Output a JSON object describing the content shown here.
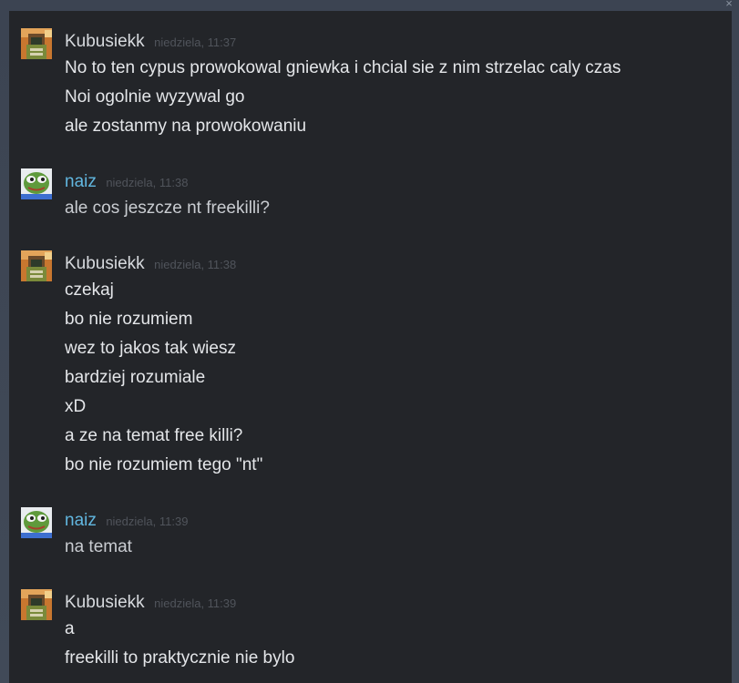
{
  "window": {
    "close_glyph": "×",
    "accent_friend": "#62b7e0",
    "background": "#232529"
  },
  "messages": [
    {
      "sender": "Kubusiekk",
      "timestamp": "niedziela, 11:37",
      "avatar_icon": "kubusiekk-avatar-icon",
      "lines": [
        "No to ten cypus prowokowal gniewka i chcial sie z nim strzelac caly czas",
        "Noi ogolnie wyzywal go",
        "ale zostanmy na prowokowaniu"
      ]
    },
    {
      "sender": "naiz",
      "timestamp": "niedziela, 11:38",
      "avatar_icon": "pepe-frog-avatar-icon",
      "lines": [
        "ale cos jeszcze nt freekilli?"
      ]
    },
    {
      "sender": "Kubusiekk",
      "timestamp": "niedziela, 11:38",
      "avatar_icon": "kubusiekk-avatar-icon",
      "lines": [
        "czekaj",
        "bo nie rozumiem",
        "wez to jakos tak wiesz",
        "bardziej rozumiale",
        "xD",
        "a ze na temat free killi?",
        "bo nie rozumiem tego \"nt\""
      ]
    },
    {
      "sender": "naiz",
      "timestamp": "niedziela, 11:39",
      "avatar_icon": "pepe-frog-avatar-icon",
      "lines": [
        "na temat"
      ]
    },
    {
      "sender": "Kubusiekk",
      "timestamp": "niedziela, 11:39",
      "avatar_icon": "kubusiekk-avatar-icon",
      "lines": [
        "a",
        "freekilli to praktycznie nie bylo"
      ]
    }
  ]
}
